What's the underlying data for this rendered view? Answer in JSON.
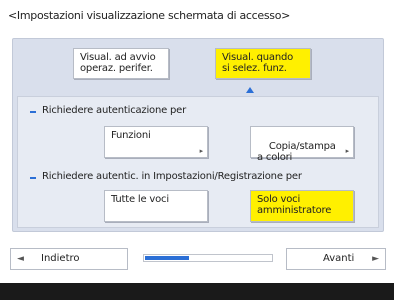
{
  "title": "<Impostazioni visualizzazione schermata di accesso>",
  "display_options": {
    "periph_label": "Visual. ad avvio\noperaz. perifer.",
    "func_label": "Visual. quando\nsi selez. funz."
  },
  "auth_section": {
    "heading": "Richiedere autenticazione per",
    "functions_label": "Funzioni",
    "color_copy_print_label": "Copia/stampa\na colori"
  },
  "registration_section": {
    "heading": "Richiedere autentic. in Impostazioni/Registrazione per",
    "all_items_label": "Tutte le voci",
    "admin_only_label": "Solo voci\namministratore"
  },
  "footer": {
    "back_label": "Indietro",
    "next_label": "Avanti",
    "progress": 0.35
  },
  "colors": {
    "selected": "#fff000",
    "accent": "#2b6fd6"
  }
}
